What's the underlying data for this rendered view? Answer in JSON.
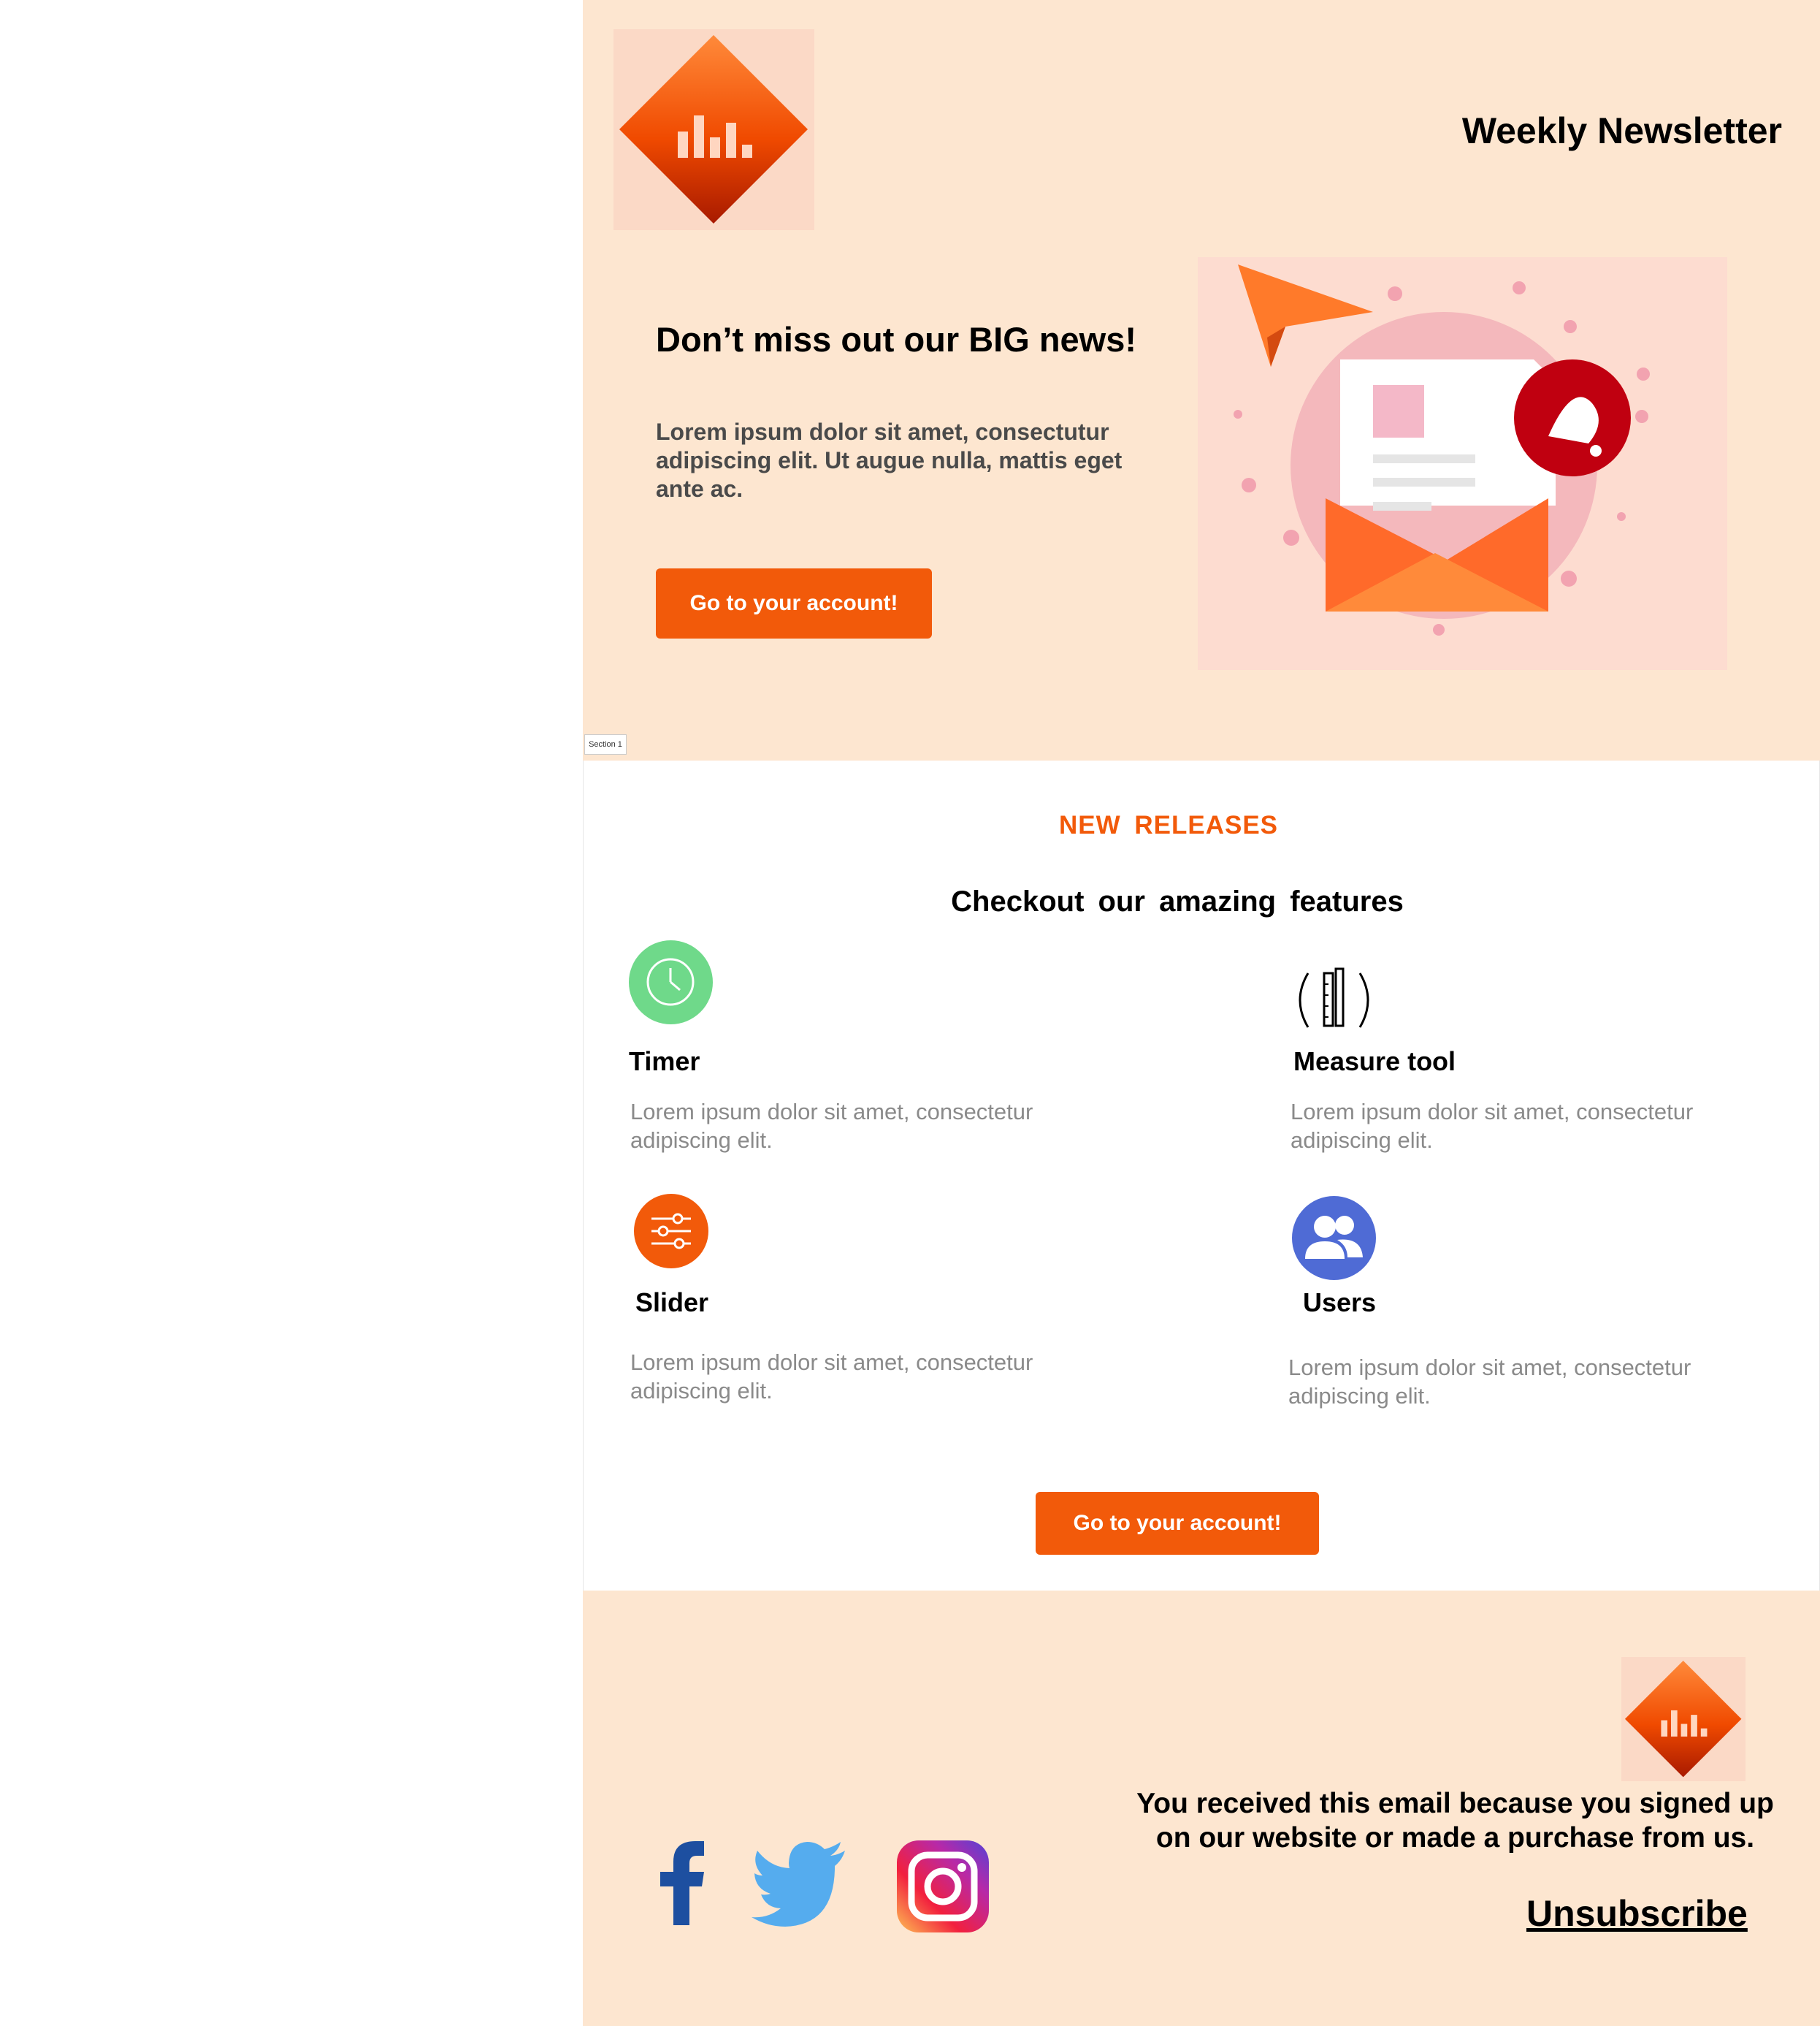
{
  "header": {
    "title": "Weekly Newsletter",
    "logo_icon": "equalizer-diamond-icon"
  },
  "hero": {
    "headline": "Don’t miss out our BIG news!",
    "body": "Lorem ipsum dolor sit amet,  consectutur adipiscing elit. Ut augue nulla, mattis eget ante ac.",
    "button_label": "Go to your account!",
    "illustration_icon": "envelope-paper-plane-bell-illustration",
    "section_tag": "Section 1"
  },
  "features": {
    "eyebrow": "NEW  RELEASES",
    "title": "Checkout  our  amazing  features",
    "items": [
      {
        "title": "Timer",
        "body": "Lorem  ipsum dolor sit amet,  consectetur adipiscing elit.",
        "icon": "clock-icon",
        "color": "#6fd98a"
      },
      {
        "title": "Measure tool",
        "body": "Lorem  ipsum dolor sit amet,  consectetur adipiscing elit.",
        "icon": "ruler-pencil-icon",
        "color": "#000000"
      },
      {
        "title": "Slider",
        "body": "Lorem  ipsum dolor sit amet,  consectetur adipiscing elit.",
        "icon": "sliders-icon",
        "color": "#f25a0a"
      },
      {
        "title": "Users",
        "body": "Lorem  ipsum dolor sit amet,  consectetur adipiscing elit.",
        "icon": "users-icon",
        "color": "#4f6bd5"
      }
    ],
    "button_label": "Go to your account!"
  },
  "footer": {
    "notice": "You received this email because you signed up on our website or made a purchase from us.",
    "unsubscribe": "Unsubscribe",
    "social": [
      "facebook-icon",
      "twitter-icon",
      "instagram-icon"
    ]
  },
  "colors": {
    "accent": "#f25a0a",
    "background": "#fde6d0",
    "facebook": "#1d4fa0",
    "twitter": "#55acee"
  }
}
